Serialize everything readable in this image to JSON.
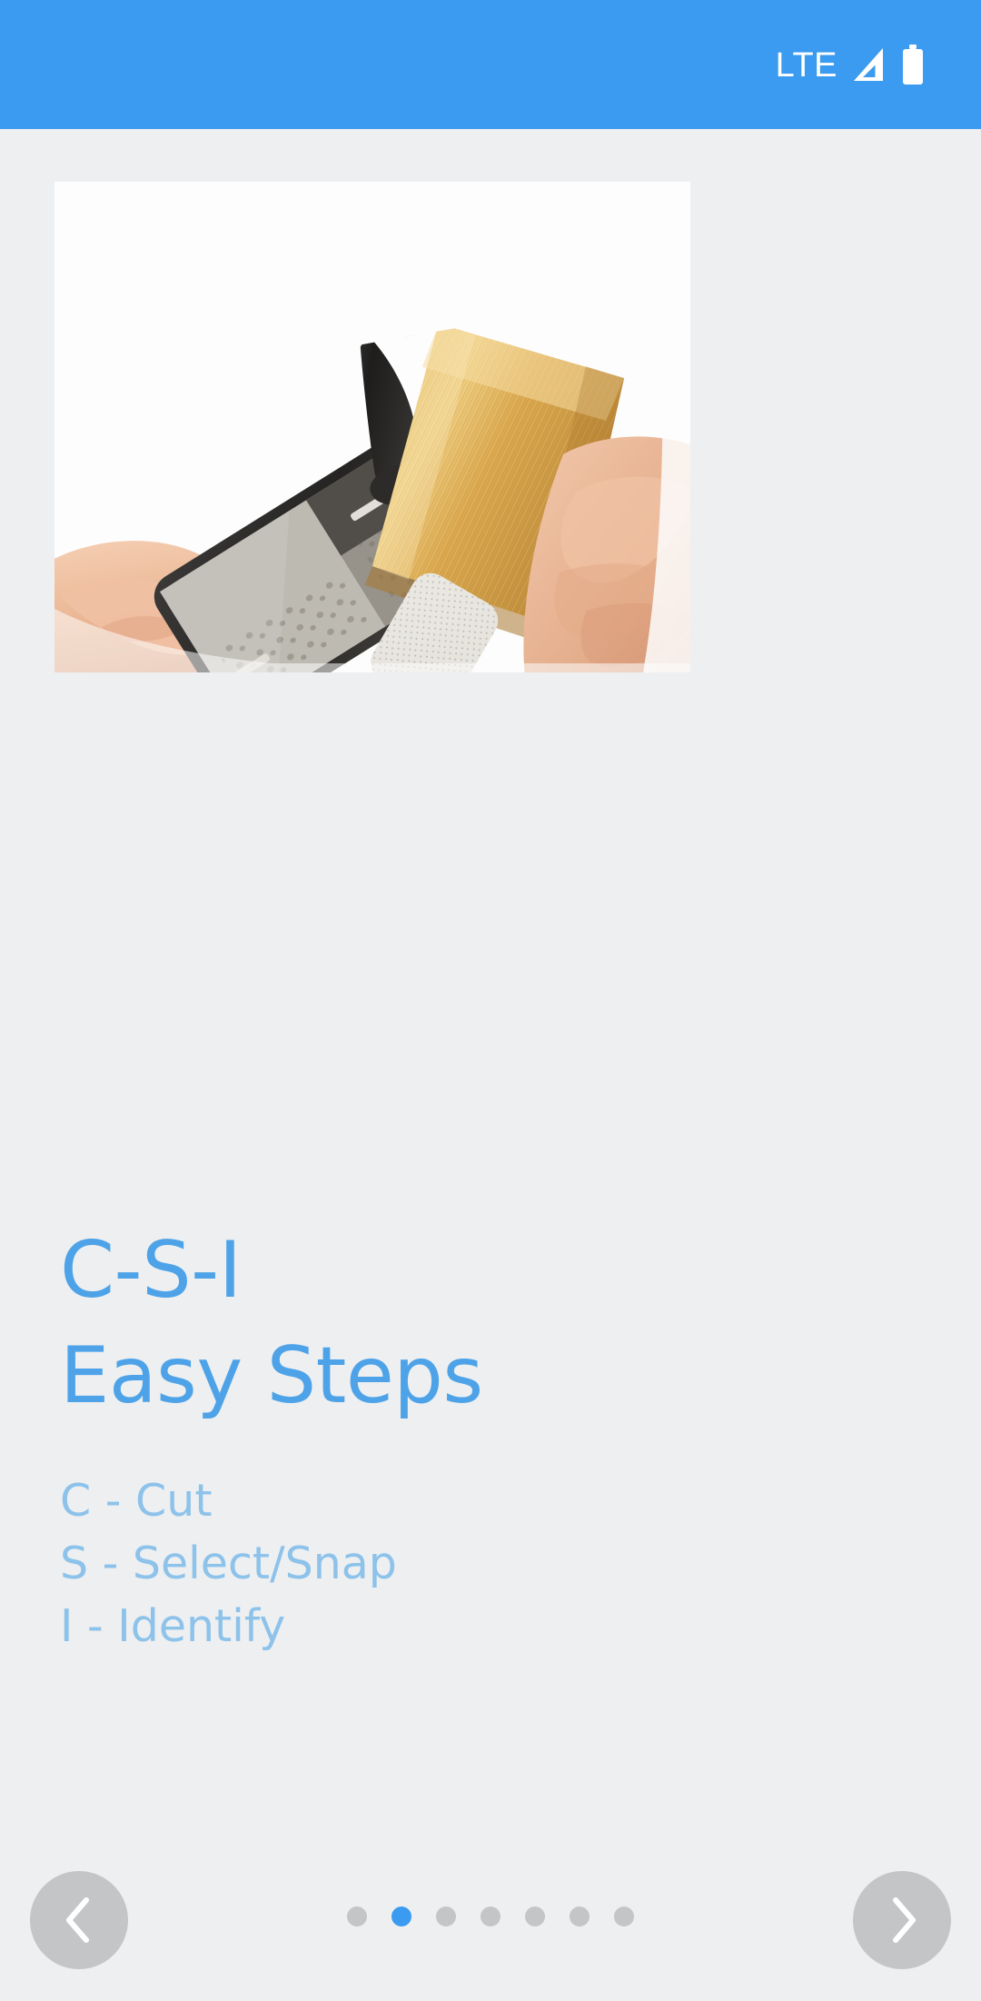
{
  "status_bar": {
    "network_label": "LTE",
    "signal_icon": "signal-triangle-icon",
    "battery_icon": "battery-full-icon",
    "background_color": "#3a9bf0"
  },
  "hero": {
    "alt": "Hand holding a smartphone with a clip-on macro lens photographing the end grain of a golden wood block held in the other hand",
    "icon": "clip-on-macro-lens-photo"
  },
  "content": {
    "title_lines": [
      "C-S-I",
      "Easy Steps"
    ],
    "steps": [
      "C - Cut",
      "S - Select/Snap",
      "I - Identify"
    ],
    "title_color": "#4ea3e8",
    "step_color": "#8dc2ea",
    "background_color": "#edeff1"
  },
  "navigation": {
    "prev_label": "Previous",
    "prev_icon": "chevron-left-icon",
    "next_label": "Next",
    "next_icon": "chevron-right-icon",
    "total_pages": 7,
    "current_page": 2,
    "dot_color": "#c3c5c7",
    "active_dot_color": "#3a9bf0"
  }
}
